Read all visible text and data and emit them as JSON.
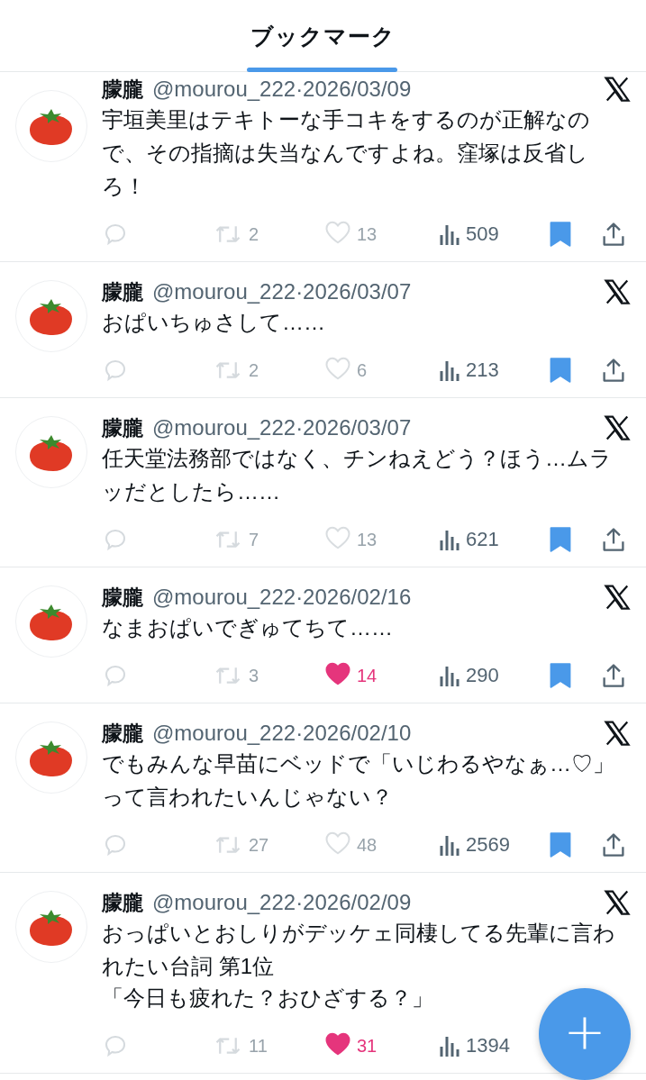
{
  "header": {
    "title": "ブックマーク"
  },
  "tweets": [
    {
      "name": "朦朧",
      "handle_date": "@mourou_222·2026/03/09",
      "text": "宇垣美里はテキトーな手コキをするのが正解なので、その指摘は失当なんですよね。窪塚は反省しろ！",
      "retweets": "2",
      "likes": "13",
      "liked": false,
      "views": "509",
      "bookmarked": true
    },
    {
      "name": "朦朧",
      "handle_date": "@mourou_222·2026/03/07",
      "text": "おぱいちゅさして……",
      "retweets": "2",
      "likes": "6",
      "liked": false,
      "views": "213",
      "bookmarked": true
    },
    {
      "name": "朦朧",
      "handle_date": "@mourou_222·2026/03/07",
      "text": "任天堂法務部ではなく、チンねえどう？ほう…ムラッだとしたら……",
      "retweets": "7",
      "likes": "13",
      "liked": false,
      "views": "621",
      "bookmarked": true
    },
    {
      "name": "朦朧",
      "handle_date": "@mourou_222·2026/02/16",
      "text": "なまおぱいでぎゅてちて……",
      "retweets": "3",
      "likes": "14",
      "liked": true,
      "views": "290",
      "bookmarked": true
    },
    {
      "name": "朦朧",
      "handle_date": "@mourou_222·2026/02/10",
      "text": "でもみんな早苗にベッドで「いじわるやなぁ…♡」って言われたいんじゃない？",
      "retweets": "27",
      "likes": "48",
      "liked": false,
      "views": "2569",
      "bookmarked": true
    },
    {
      "name": "朦朧",
      "handle_date": "@mourou_222·2026/02/09",
      "text": "おっぱいとおしりがデッケェ同棲してる先輩に言われたい台詞 第1位",
      "text_2": "「今日も疲れた？おひざする？」",
      "retweets": "11",
      "likes": "31",
      "liked": true,
      "views": "1394"
    }
  ],
  "fab": {
    "label": "+"
  }
}
